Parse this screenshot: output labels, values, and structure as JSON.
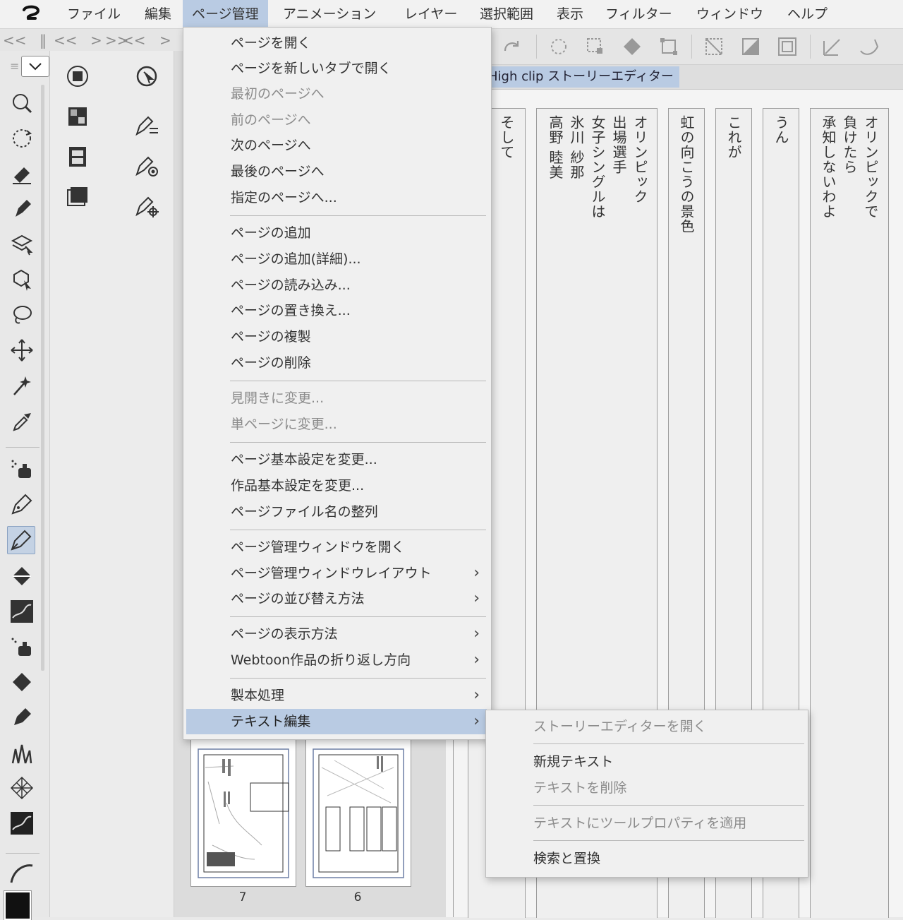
{
  "menubar": {
    "items": [
      "ファイル",
      "編集",
      "ページ管理",
      "アニメーション",
      "レイヤー",
      "選択範囲",
      "表示",
      "フィルター",
      "ウィンドウ",
      "ヘルプ"
    ]
  },
  "toolbar": {
    "nav": [
      "<<",
      "<<",
      ">",
      ">>",
      "<<",
      ">"
    ]
  },
  "story_tab": {
    "label": "High  clip ストーリーエディター"
  },
  "pages": {
    "numbers": [
      "7",
      "6"
    ]
  },
  "story_columns": [
    "そして",
    "高野 睦美",
    "氷川 紗那",
    "女子シングルは",
    "出場選手",
    "オリンピック",
    "虹の向こうの景色",
    "これが",
    "うん",
    "承知しないわよ",
    "負けたら",
    "オリンピックで"
  ],
  "main_menu": {
    "items": [
      {
        "label": "ページを開く",
        "disabled": false,
        "submenu": false
      },
      {
        "label": "ページを新しいタブで開く",
        "disabled": false,
        "submenu": false
      },
      {
        "label": "最初のページへ",
        "disabled": true,
        "submenu": false
      },
      {
        "label": "前のページへ",
        "disabled": true,
        "submenu": false
      },
      {
        "label": "次のページへ",
        "disabled": false,
        "submenu": false
      },
      {
        "label": "最後のページへ",
        "disabled": false,
        "submenu": false
      },
      {
        "label": "指定のページへ...",
        "disabled": false,
        "submenu": false
      },
      {
        "label": "ページの追加",
        "disabled": false,
        "submenu": false
      },
      {
        "label": "ページの追加(詳細)...",
        "disabled": false,
        "submenu": false
      },
      {
        "label": "ページの読み込み...",
        "disabled": false,
        "submenu": false
      },
      {
        "label": "ページの置き換え...",
        "disabled": false,
        "submenu": false
      },
      {
        "label": "ページの複製",
        "disabled": false,
        "submenu": false
      },
      {
        "label": "ページの削除",
        "disabled": false,
        "submenu": false
      },
      {
        "label": "見開きに変更...",
        "disabled": true,
        "submenu": false
      },
      {
        "label": "単ページに変更...",
        "disabled": true,
        "submenu": false
      },
      {
        "label": "ページ基本設定を変更...",
        "disabled": false,
        "submenu": false
      },
      {
        "label": "作品基本設定を変更...",
        "disabled": false,
        "submenu": false
      },
      {
        "label": "ページファイル名の整列",
        "disabled": false,
        "submenu": false
      },
      {
        "label": "ページ管理ウィンドウを開く",
        "disabled": false,
        "submenu": false
      },
      {
        "label": "ページ管理ウィンドウレイアウト",
        "disabled": false,
        "submenu": true
      },
      {
        "label": "ページの並び替え方法",
        "disabled": false,
        "submenu": true
      },
      {
        "label": "ページの表示方法",
        "disabled": false,
        "submenu": true
      },
      {
        "label": "Webtoon作品の折り返し方向",
        "disabled": false,
        "submenu": true
      },
      {
        "label": "製本処理",
        "disabled": false,
        "submenu": true
      },
      {
        "label": "テキスト編集",
        "disabled": false,
        "submenu": true,
        "highlighted": true
      }
    ]
  },
  "sub_menu": {
    "items": [
      {
        "label": "ストーリーエディターを開く",
        "disabled": true
      },
      {
        "label": "新規テキスト",
        "disabled": false
      },
      {
        "label": "テキストを削除",
        "disabled": true
      },
      {
        "label": "テキストにツールプロパティを適用",
        "disabled": true
      },
      {
        "label": "検索と置換",
        "disabled": false
      }
    ]
  },
  "colors": {
    "highlight": "#b9cbe3",
    "main_color": "#111111"
  }
}
